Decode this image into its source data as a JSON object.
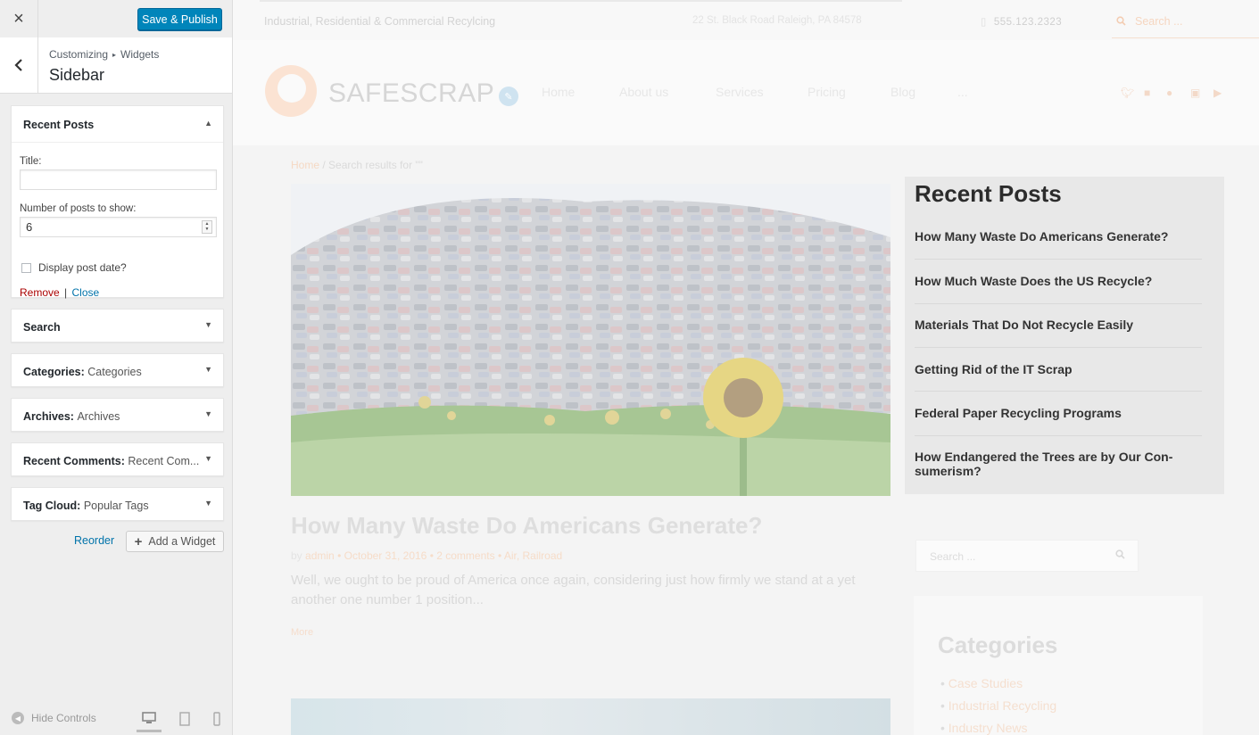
{
  "customizer": {
    "close_label": "×",
    "save_label": "Save & Publish",
    "breadcrumb": [
      "Customizing",
      "Widgets"
    ],
    "breadcrumb_sep": "▸",
    "section_title": "Sidebar",
    "expanded_widget": {
      "title": "Recent Posts",
      "title_field_label": "Title:",
      "title_field_value": "",
      "count_label": "Number of posts to show:",
      "count_value": "6",
      "show_date_label": "Display post date?",
      "show_date_checked": false,
      "remove_label": "Remove",
      "separator": "|",
      "close_label": "Close"
    },
    "collapsed_widgets": [
      {
        "title": "Search",
        "sub": ""
      },
      {
        "title": "Categories:",
        "sub": "Categories"
      },
      {
        "title": "Archives:",
        "sub": "Archives"
      },
      {
        "title": "Recent Comments:",
        "sub": "Recent Com..."
      },
      {
        "title": "Tag Cloud:",
        "sub": "Popular Tags"
      }
    ],
    "reorder_label": "Reorder",
    "add_widget_label": "Add a Widget",
    "hide_controls_label": "Hide Controls"
  },
  "preview": {
    "tagline": "Industrial, Residential & Commercial Recylcing",
    "address": "22 St. Black Road Raleigh, PA 84578",
    "phone": "555.123.2323",
    "search_placeholder": "Search ...",
    "logo_text": "SAFESCRAP",
    "nav": [
      "Home",
      "About us",
      "Services",
      "Pricing",
      "Blog",
      "..."
    ],
    "breadcrumb_home": "Home",
    "breadcrumb_rest": "/ Search results for \"\"",
    "post_title": "How Many Waste Do Americans Generate?",
    "post_meta": {
      "by": "by",
      "author": "admin",
      "date": "October 31, 2016",
      "comments": "2 comments",
      "tags": "Air, Railroad"
    },
    "post_excerpt": "Well, we ought to be proud of America once again, considering just how firmly we stand at a yet another one number 1 position...",
    "more_label": "More",
    "recent_posts": {
      "title": "Recent Posts",
      "items": [
        "How Many Waste Do Americans Generate?",
        "How Much Waste Does the US Recycle?",
        "Materials That Do Not Recycle Easily",
        "Getting Rid of the IT Scrap",
        "Federal Paper Recycling Programs",
        "How Endangered the Trees are by Our Con-sumerism?"
      ]
    },
    "sidebar_search_placeholder": "Search ...",
    "categories": {
      "title": "Categories",
      "items": [
        "Case Studies",
        "Industrial Recycling",
        "Industry News"
      ]
    }
  }
}
